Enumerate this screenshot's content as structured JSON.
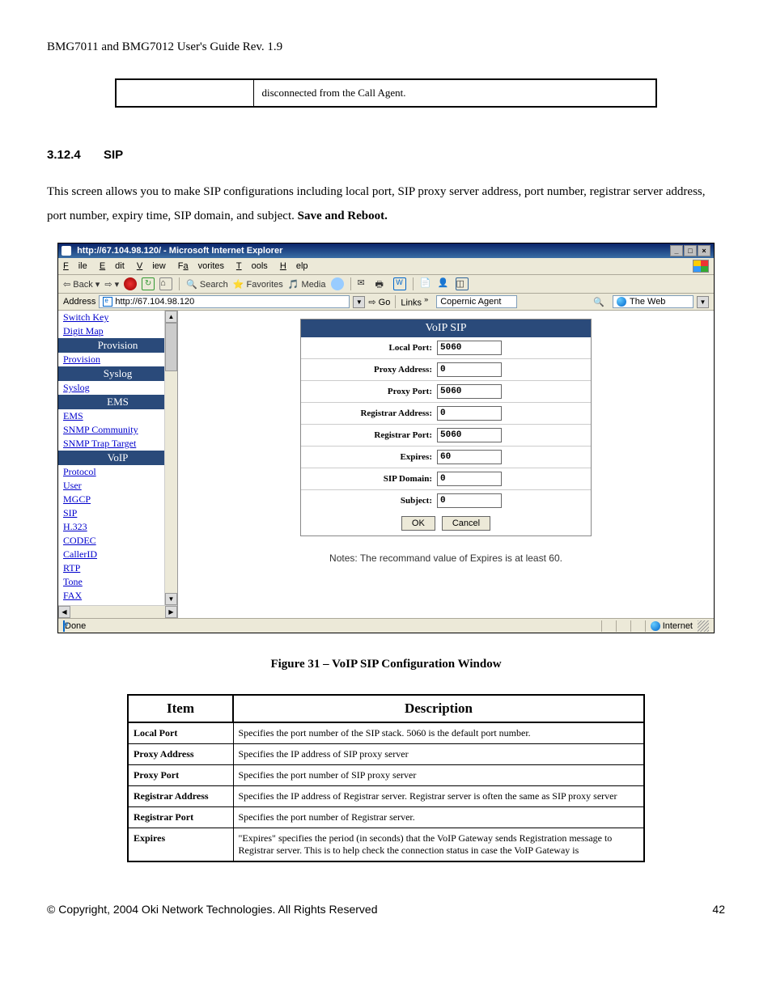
{
  "doc_header": "BMG7011 and BMG7012 User's Guide Rev. 1.9",
  "top_fragment": "disconnected from the Call Agent.",
  "section": {
    "num": "3.12.4",
    "title": "SIP"
  },
  "paragraph_a": "This screen allows you to make SIP configurations including local port, SIP proxy server address, port number, registrar server address, port number, expiry time, SIP domain, and subject. ",
  "paragraph_b_bold": "Save and Reboot.",
  "ie": {
    "title": "http://67.104.98.120/ - Microsoft Internet Explorer",
    "menus": [
      "File",
      "Edit",
      "View",
      "Favorites",
      "Tools",
      "Help"
    ],
    "tb": {
      "back": "Back",
      "search": "Search",
      "favorites": "Favorites",
      "media": "Media"
    },
    "address_label": "Address",
    "address_url": "http://67.104.98.120",
    "go": "Go",
    "links": "Links",
    "copernic": "Copernic Agent",
    "theweb": "The Web",
    "status_left": "Done",
    "status_right": "Internet"
  },
  "sidebar": {
    "links_top": [
      "Switch Key",
      "Digit Map"
    ],
    "heads": [
      "Provision",
      "Syslog",
      "EMS",
      "VoIP"
    ],
    "under_provision": [
      "Provision"
    ],
    "under_syslog": [
      "Syslog"
    ],
    "under_ems": [
      "EMS",
      "SNMP Community",
      "SNMP Trap Target"
    ],
    "under_voip": [
      "Protocol",
      "User",
      "MGCP",
      "SIP",
      "H.323",
      "CODEC",
      "CallerID",
      "RTP",
      "Tone",
      "FAX"
    ]
  },
  "form": {
    "title": "VoIP SIP",
    "rows": [
      {
        "label": "Local Port:",
        "value": "5060"
      },
      {
        "label": "Proxy Address:",
        "value": "0"
      },
      {
        "label": "Proxy Port:",
        "value": "5060"
      },
      {
        "label": "Registrar Address:",
        "value": "0"
      },
      {
        "label": "Registrar Port:",
        "value": "5060"
      },
      {
        "label": "Expires:",
        "value": "60"
      },
      {
        "label": "SIP Domain:",
        "value": "0"
      },
      {
        "label": "Subject:",
        "value": "0"
      }
    ],
    "ok": "OK",
    "cancel": "Cancel",
    "notes": "Notes: The recommand value of Expires is at least 60."
  },
  "fig_caption": "Figure 31 – VoIP SIP Configuration Window",
  "desc_table": {
    "head": [
      "Item",
      "Description"
    ],
    "rows": [
      [
        "Local Port",
        "Specifies the port number of the SIP stack. 5060 is the default port number."
      ],
      [
        "Proxy Address",
        "Specifies the IP address of SIP proxy server"
      ],
      [
        "Proxy Port",
        "Specifies the port number of SIP proxy server"
      ],
      [
        "Registrar Address",
        "Specifies the IP address of Registrar server. Registrar server is often the same as SIP proxy server"
      ],
      [
        "Registrar Port",
        "Specifies the port number of Registrar server."
      ],
      [
        "Expires",
        "\"Expires\" specifies the period (in seconds) that the VoIP Gateway sends Registration message to Registrar server. This is to help check the connection status in case the VoIP Gateway is"
      ]
    ]
  },
  "footer": {
    "left": "© Copyright, 2004 Oki Network Technologies. All Rights Reserved",
    "right": "42"
  }
}
